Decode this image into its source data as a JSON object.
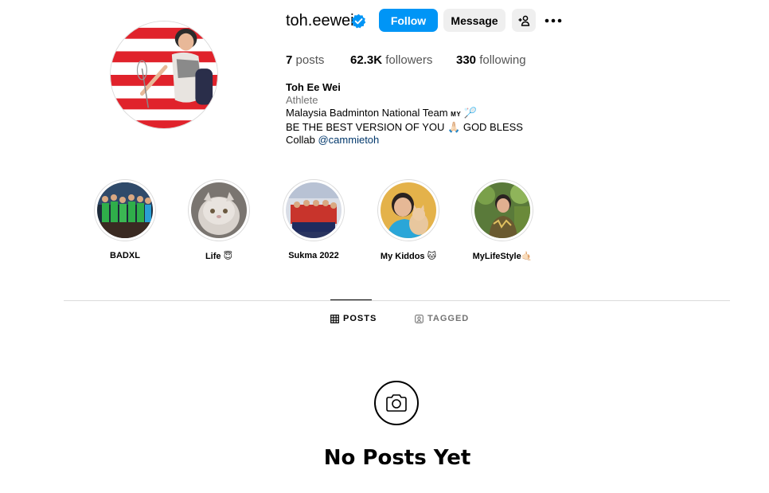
{
  "profile": {
    "username": "toh.eewei",
    "follow_label": "Follow",
    "message_label": "Message",
    "stats": {
      "posts_count": "7",
      "posts_label": "posts",
      "followers_count": "62.3K",
      "followers_label": "followers",
      "following_count": "330",
      "following_label": "following"
    },
    "bio": {
      "full_name": "Toh Ee Wei",
      "category": "Athlete",
      "line1": "Malaysia Badminton National Team",
      "line1_flag": "MY",
      "line1_emoji": "🏸",
      "line2": "BE THE BEST VERSION OF YOU",
      "line2_emoji1": "🙏🏻",
      "line2_tail": "GOD BLESS",
      "line3_prefix": "Collab",
      "line3_link": "@cammietoh"
    }
  },
  "highlights": [
    {
      "label": "BADXL"
    },
    {
      "label": "Life 😇"
    },
    {
      "label": "Sukma 2022"
    },
    {
      "label": "My Kiddos 🐱"
    },
    {
      "label": "MyLifeStyle🤙🏻"
    }
  ],
  "tabs": {
    "posts": "POSTS",
    "tagged": "TAGGED"
  },
  "empty_state": {
    "title": "No Posts Yet"
  },
  "colors": {
    "primary": "#0095f6",
    "secondary_button": "#efefef",
    "verified": "#0095f6",
    "link": "#00376b"
  }
}
